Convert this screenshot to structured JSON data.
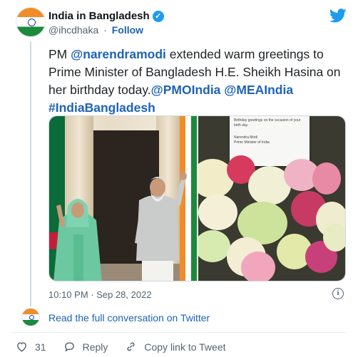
{
  "tweet": {
    "author_name": "India in Bangladesh",
    "handle": "@ihcdhaka",
    "separator": "·",
    "follow_label": "Follow",
    "text_prefix": "PM ",
    "mention_1": "@narendramodi",
    "text_middle": " extended warm greetings to Prime Minister of Bangladesh H.E. Sheikh Hasina on her birthday today.",
    "mention_2": "@PMOIndia",
    "mention_3": "@MEAIndia",
    "hashtag": "#IndiaBangladesh",
    "timestamp": "10:10 PM · Sep 28, 2022",
    "info_glyph": "i",
    "note_lines": [
      "Birthday greetings on the occasion of your birth day.",
      "Narendra Modi",
      "Prime Minister of India"
    ]
  },
  "conversation": {
    "link_label": "Read the full conversation on Twitter"
  },
  "actions": {
    "like_count": "31",
    "reply_label": "Reply",
    "copy_label": "Copy link to Tweet"
  },
  "icons": {
    "verified": "verified-badge-icon",
    "brand": "twitter-bird-icon",
    "info": "info-icon",
    "like": "heart-icon",
    "reply": "speech-bubble-icon",
    "copy": "link-icon"
  },
  "colors": {
    "link": "#1d63b8",
    "brand": "#1d9bf0",
    "muted": "#536471",
    "text": "#0f1419"
  }
}
